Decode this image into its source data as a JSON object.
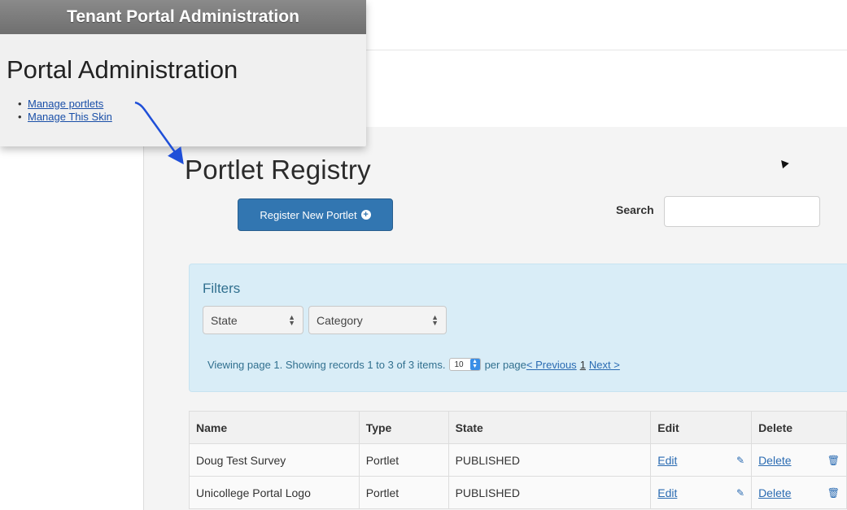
{
  "tenant": {
    "bar_title": "Tenant Portal Administration",
    "heading": "Portal Administration",
    "links": [
      "Manage portlets",
      "Manage This Skin"
    ]
  },
  "registry": {
    "title": "Portlet Registry",
    "register_button": "Register New Portlet",
    "search_label": "Search",
    "search_value": "",
    "filters": {
      "title": "Filters",
      "state_select": "State",
      "category_select": "Category",
      "paging_text": "Viewing page 1. Showing records 1 to 3 of 3 items.",
      "per_page_value": "10",
      "per_page_label": "per page",
      "prev_link": "< Previous",
      "current_page": "1",
      "next_link": "Next >"
    },
    "table": {
      "headers": [
        "Name",
        "Type",
        "State",
        "Edit",
        "Delete"
      ],
      "rows": [
        {
          "name": "Doug Test Survey",
          "type": "Portlet",
          "state": "PUBLISHED",
          "edit": "Edit",
          "delete": "Delete"
        },
        {
          "name": "Unicollege Portal Logo",
          "type": "Portlet",
          "state": "PUBLISHED",
          "edit": "Edit",
          "delete": "Delete"
        }
      ]
    }
  },
  "icons": {
    "plus": "plus-circle-icon",
    "edit": "pencil-square-icon",
    "delete": "trash-icon",
    "select": "up-down-arrows-icon",
    "annotation": "blue-arrow"
  },
  "colors": {
    "primary_button": "#3276b1",
    "filters_bg": "#d9edf7",
    "link": "#2a6bb2",
    "annotation_arrow": "#1f4fd8"
  }
}
